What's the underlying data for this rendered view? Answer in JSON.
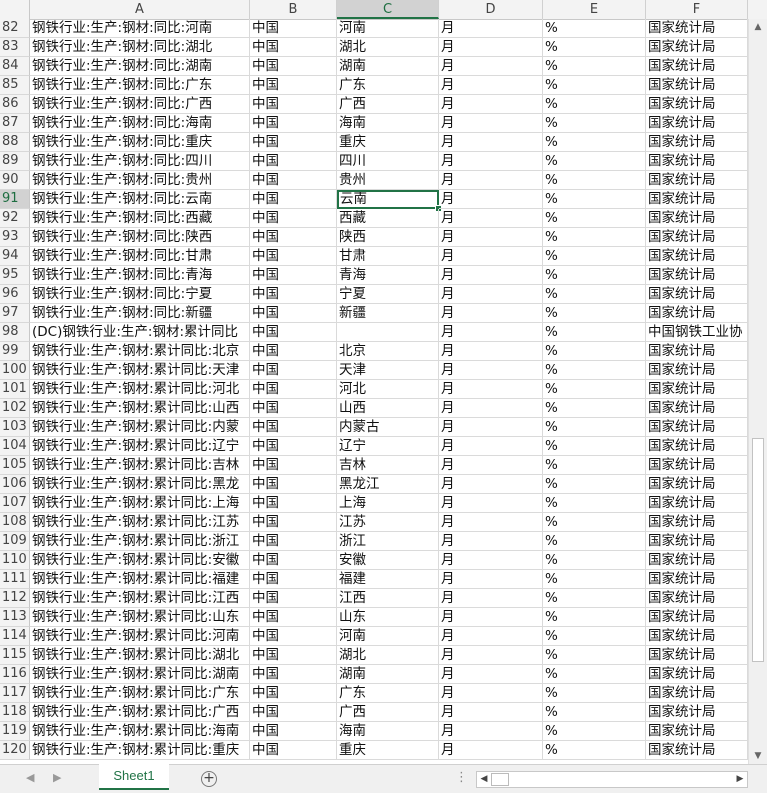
{
  "columns": [
    "A",
    "B",
    "C",
    "D",
    "E",
    "F"
  ],
  "selected_column": "C",
  "active_cell": "C91",
  "rows": [
    {
      "n": "82",
      "a": "钢铁行业:生产:钢材:同比:河南",
      "b": "中国",
      "c": "河南",
      "d": "月",
      "e": "%",
      "f": "国家统计局"
    },
    {
      "n": "83",
      "a": "钢铁行业:生产:钢材:同比:湖北",
      "b": "中国",
      "c": "湖北",
      "d": "月",
      "e": "%",
      "f": "国家统计局"
    },
    {
      "n": "84",
      "a": "钢铁行业:生产:钢材:同比:湖南",
      "b": "中国",
      "c": "湖南",
      "d": "月",
      "e": "%",
      "f": "国家统计局"
    },
    {
      "n": "85",
      "a": "钢铁行业:生产:钢材:同比:广东",
      "b": "中国",
      "c": "广东",
      "d": "月",
      "e": "%",
      "f": "国家统计局"
    },
    {
      "n": "86",
      "a": "钢铁行业:生产:钢材:同比:广西",
      "b": "中国",
      "c": "广西",
      "d": "月",
      "e": "%",
      "f": "国家统计局"
    },
    {
      "n": "87",
      "a": "钢铁行业:生产:钢材:同比:海南",
      "b": "中国",
      "c": "海南",
      "d": "月",
      "e": "%",
      "f": "国家统计局"
    },
    {
      "n": "88",
      "a": "钢铁行业:生产:钢材:同比:重庆",
      "b": "中国",
      "c": "重庆",
      "d": "月",
      "e": "%",
      "f": "国家统计局"
    },
    {
      "n": "89",
      "a": "钢铁行业:生产:钢材:同比:四川",
      "b": "中国",
      "c": "四川",
      "d": "月",
      "e": "%",
      "f": "国家统计局"
    },
    {
      "n": "90",
      "a": "钢铁行业:生产:钢材:同比:贵州",
      "b": "中国",
      "c": "贵州",
      "d": "月",
      "e": "%",
      "f": "国家统计局"
    },
    {
      "n": "91",
      "a": "钢铁行业:生产:钢材:同比:云南",
      "b": "中国",
      "c": "云南",
      "d": "月",
      "e": "%",
      "f": "国家统计局"
    },
    {
      "n": "92",
      "a": "钢铁行业:生产:钢材:同比:西藏",
      "b": "中国",
      "c": "西藏",
      "d": "月",
      "e": "%",
      "f": "国家统计局"
    },
    {
      "n": "93",
      "a": "钢铁行业:生产:钢材:同比:陕西",
      "b": "中国",
      "c": "陕西",
      "d": "月",
      "e": "%",
      "f": "国家统计局"
    },
    {
      "n": "94",
      "a": "钢铁行业:生产:钢材:同比:甘肃",
      "b": "中国",
      "c": "甘肃",
      "d": "月",
      "e": "%",
      "f": "国家统计局"
    },
    {
      "n": "95",
      "a": "钢铁行业:生产:钢材:同比:青海",
      "b": "中国",
      "c": "青海",
      "d": "月",
      "e": "%",
      "f": "国家统计局"
    },
    {
      "n": "96",
      "a": "钢铁行业:生产:钢材:同比:宁夏",
      "b": "中国",
      "c": "宁夏",
      "d": "月",
      "e": "%",
      "f": "国家统计局"
    },
    {
      "n": "97",
      "a": "钢铁行业:生产:钢材:同比:新疆",
      "b": "中国",
      "c": "新疆",
      "d": "月",
      "e": "%",
      "f": "国家统计局"
    },
    {
      "n": "98",
      "a": "(DC)钢铁行业:生产:钢材:累计同比",
      "b": "中国",
      "c": "",
      "d": "月",
      "e": "%",
      "f": "中国钢铁工业协"
    },
    {
      "n": "99",
      "a": "钢铁行业:生产:钢材:累计同比:北京",
      "b": "中国",
      "c": "北京",
      "d": "月",
      "e": "%",
      "f": "国家统计局"
    },
    {
      "n": "100",
      "a": "钢铁行业:生产:钢材:累计同比:天津",
      "b": "中国",
      "c": "天津",
      "d": "月",
      "e": "%",
      "f": "国家统计局"
    },
    {
      "n": "101",
      "a": "钢铁行业:生产:钢材:累计同比:河北",
      "b": "中国",
      "c": "河北",
      "d": "月",
      "e": "%",
      "f": "国家统计局"
    },
    {
      "n": "102",
      "a": "钢铁行业:生产:钢材:累计同比:山西",
      "b": "中国",
      "c": "山西",
      "d": "月",
      "e": "%",
      "f": "国家统计局"
    },
    {
      "n": "103",
      "a": "钢铁行业:生产:钢材:累计同比:内蒙",
      "b": "中国",
      "c": "内蒙古",
      "d": "月",
      "e": "%",
      "f": "国家统计局"
    },
    {
      "n": "104",
      "a": "钢铁行业:生产:钢材:累计同比:辽宁",
      "b": "中国",
      "c": "辽宁",
      "d": "月",
      "e": "%",
      "f": "国家统计局"
    },
    {
      "n": "105",
      "a": "钢铁行业:生产:钢材:累计同比:吉林",
      "b": "中国",
      "c": "吉林",
      "d": "月",
      "e": "%",
      "f": "国家统计局"
    },
    {
      "n": "106",
      "a": "钢铁行业:生产:钢材:累计同比:黑龙",
      "b": "中国",
      "c": "黑龙江",
      "d": "月",
      "e": "%",
      "f": "国家统计局"
    },
    {
      "n": "107",
      "a": "钢铁行业:生产:钢材:累计同比:上海",
      "b": "中国",
      "c": "上海",
      "d": "月",
      "e": "%",
      "f": "国家统计局"
    },
    {
      "n": "108",
      "a": "钢铁行业:生产:钢材:累计同比:江苏",
      "b": "中国",
      "c": "江苏",
      "d": "月",
      "e": "%",
      "f": "国家统计局"
    },
    {
      "n": "109",
      "a": "钢铁行业:生产:钢材:累计同比:浙江",
      "b": "中国",
      "c": "浙江",
      "d": "月",
      "e": "%",
      "f": "国家统计局"
    },
    {
      "n": "110",
      "a": "钢铁行业:生产:钢材:累计同比:安徽",
      "b": "中国",
      "c": "安徽",
      "d": "月",
      "e": "%",
      "f": "国家统计局"
    },
    {
      "n": "111",
      "a": "钢铁行业:生产:钢材:累计同比:福建",
      "b": "中国",
      "c": "福建",
      "d": "月",
      "e": "%",
      "f": "国家统计局"
    },
    {
      "n": "112",
      "a": "钢铁行业:生产:钢材:累计同比:江西",
      "b": "中国",
      "c": "江西",
      "d": "月",
      "e": "%",
      "f": "国家统计局"
    },
    {
      "n": "113",
      "a": "钢铁行业:生产:钢材:累计同比:山东",
      "b": "中国",
      "c": "山东",
      "d": "月",
      "e": "%",
      "f": "国家统计局"
    },
    {
      "n": "114",
      "a": "钢铁行业:生产:钢材:累计同比:河南",
      "b": "中国",
      "c": "河南",
      "d": "月",
      "e": "%",
      "f": "国家统计局"
    },
    {
      "n": "115",
      "a": "钢铁行业:生产:钢材:累计同比:湖北",
      "b": "中国",
      "c": "湖北",
      "d": "月",
      "e": "%",
      "f": "国家统计局"
    },
    {
      "n": "116",
      "a": "钢铁行业:生产:钢材:累计同比:湖南",
      "b": "中国",
      "c": "湖南",
      "d": "月",
      "e": "%",
      "f": "国家统计局"
    },
    {
      "n": "117",
      "a": "钢铁行业:生产:钢材:累计同比:广东",
      "b": "中国",
      "c": "广东",
      "d": "月",
      "e": "%",
      "f": "国家统计局"
    },
    {
      "n": "118",
      "a": "钢铁行业:生产:钢材:累计同比:广西",
      "b": "中国",
      "c": "广西",
      "d": "月",
      "e": "%",
      "f": "国家统计局"
    },
    {
      "n": "119",
      "a": "钢铁行业:生产:钢材:累计同比:海南",
      "b": "中国",
      "c": "海南",
      "d": "月",
      "e": "%",
      "f": "国家统计局"
    },
    {
      "n": "120",
      "a": "钢铁行业:生产:钢材:累计同比:重庆",
      "b": "中国",
      "c": "重庆",
      "d": "月",
      "e": "%",
      "f": "国家统计局"
    }
  ],
  "sheet_tabs": [
    {
      "label": "Sheet1",
      "active": true
    }
  ],
  "add_sheet_symbol": "+",
  "dots_symbol": "⋮",
  "icons": {
    "nav_prev": "triangle-left-icon",
    "nav_next": "triangle-right-icon",
    "add_sheet": "plus-circle-icon",
    "scroll_up": "arrow-up-icon",
    "scroll_down": "arrow-down-icon",
    "scroll_left": "arrow-left-icon",
    "scroll_right": "arrow-right-icon"
  },
  "colors": {
    "accent": "#217346",
    "header_bg": "#f3f3f3",
    "selected_header_bg": "#d2d2d2"
  }
}
